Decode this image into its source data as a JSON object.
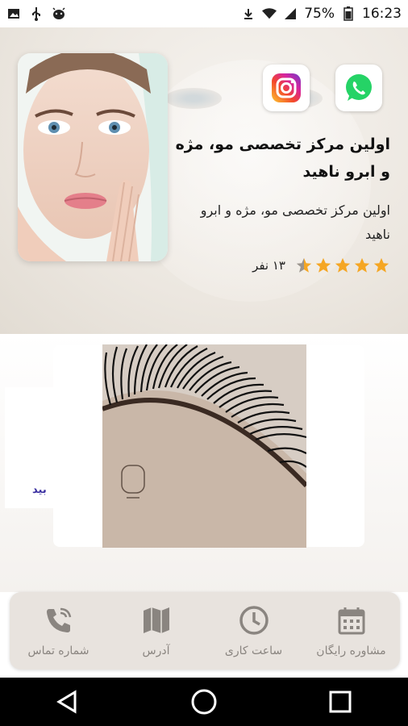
{
  "status_bar": {
    "battery": "75%",
    "time": "16:23"
  },
  "hero": {
    "title": "اولین مرکز تخصصی مو، مژه و ابرو ناهید",
    "subtitle": "اولین مرکز تخصصی مو، مژه و ابرو ناهید",
    "rating_value": 4.5,
    "rating_count": "۱۳ نفر",
    "social": {
      "instagram": "instagram-icon",
      "whatsapp": "whatsapp-icon"
    }
  },
  "gallery": {
    "side_label": "بید"
  },
  "bottom_nav": [
    {
      "label": "مشاوره رایگان",
      "icon": "calendar-icon"
    },
    {
      "label": "ساعت کاری",
      "icon": "clock-icon"
    },
    {
      "label": "آدرس",
      "icon": "map-icon"
    },
    {
      "label": "شماره تماس",
      "icon": "phone-icon"
    }
  ],
  "colors": {
    "nav_bg": "#e8e3de",
    "nav_fg": "#8a8580",
    "star": "#f5a623",
    "whatsapp": "#25d366"
  }
}
